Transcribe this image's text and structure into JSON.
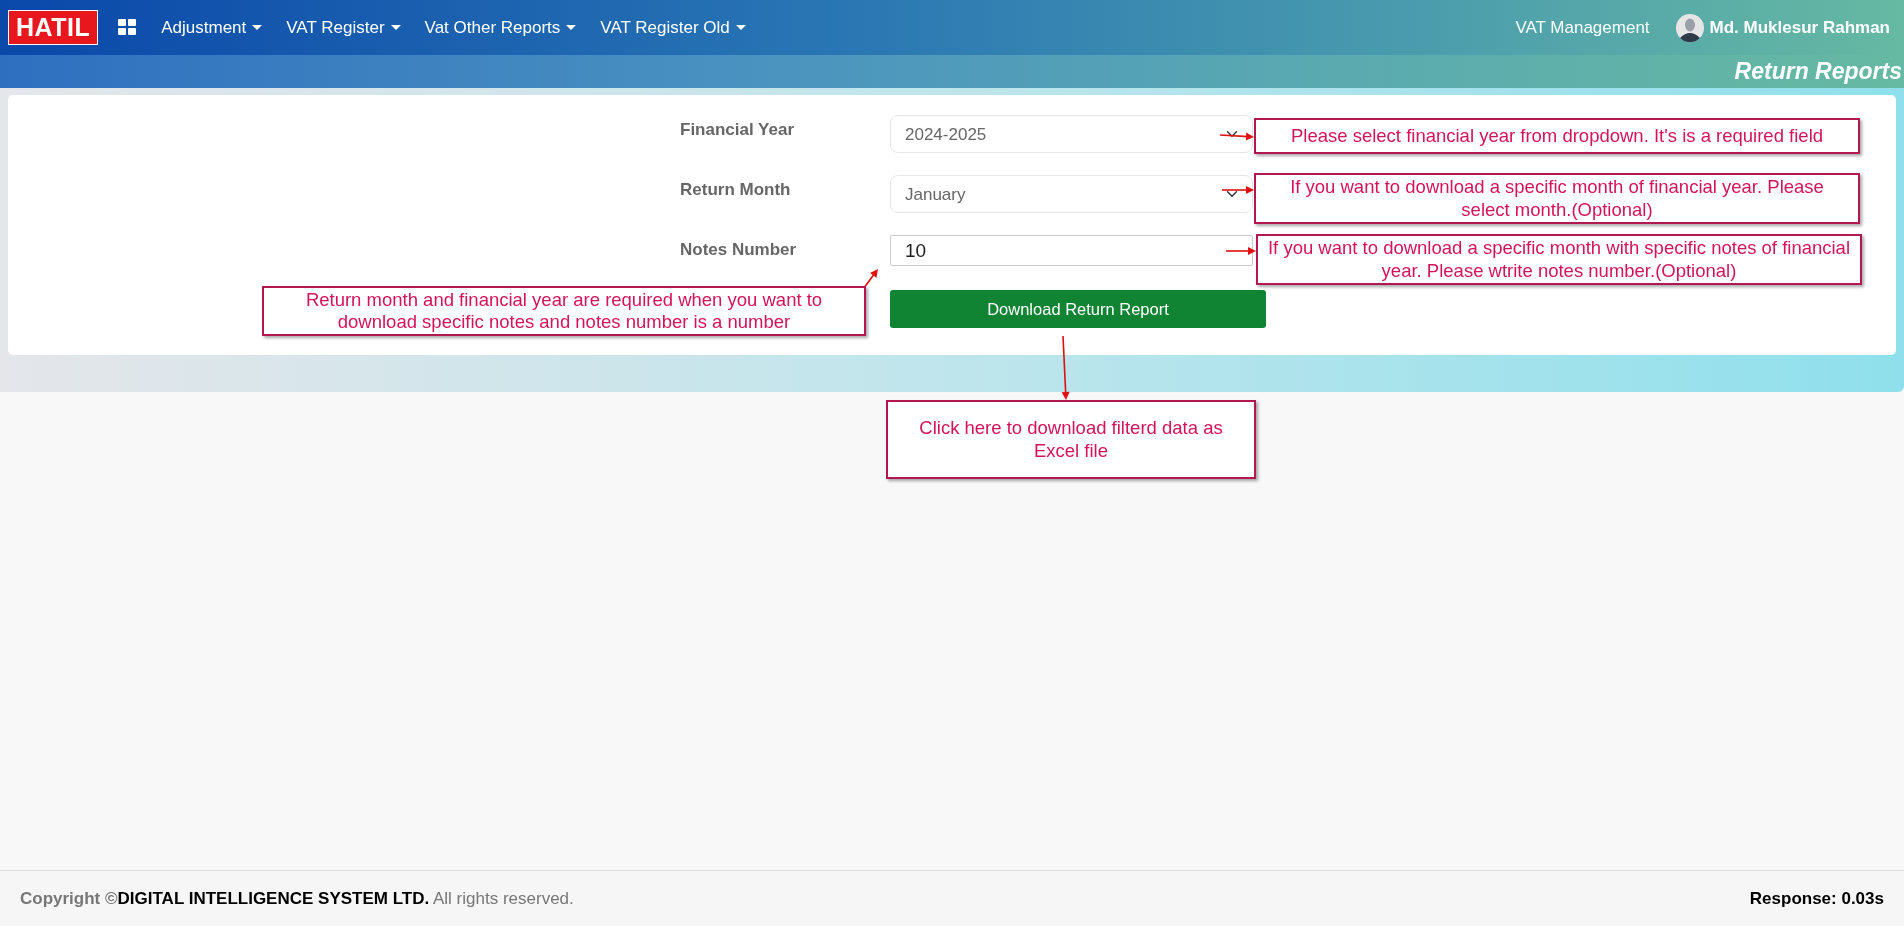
{
  "navbar": {
    "brand": "HATIL",
    "menus": [
      {
        "label": "Adjustment"
      },
      {
        "label": "VAT Register"
      },
      {
        "label": "Vat Other Reports"
      },
      {
        "label": "VAT Register Old"
      }
    ],
    "app_name": "VAT Management",
    "user_name": "Md. Muklesur Rahman"
  },
  "page_title": "Return Reports",
  "form": {
    "fields": [
      {
        "kind": "select",
        "label": "Financial Year",
        "value": "2024-2025"
      },
      {
        "kind": "select",
        "label": "Return Month",
        "value": "January"
      },
      {
        "kind": "number",
        "label": "Notes Number",
        "value": "10"
      }
    ],
    "button": "Download Return Report"
  },
  "annotations": [
    {
      "text": "Please select financial year from dropdown. It's is a required field"
    },
    {
      "text": "If you want to download a specific month of financial year. Please select month.(Optional)"
    },
    {
      "text": "If you want to download a specific month with specific notes of financial year. Please wtrite notes number.(Optional)"
    },
    {
      "text": "Return month and financial year are required when you want to download specific notes and notes number is a number"
    },
    {
      "text": "Click here to download filterd data as Excel file"
    }
  ],
  "footer": {
    "copyright": "Copyright ©",
    "company": "DIGITAL INTELLIGENCE SYSTEM LTD.",
    "rights": "All rights reserved.",
    "response": "Response: 0.03s"
  }
}
